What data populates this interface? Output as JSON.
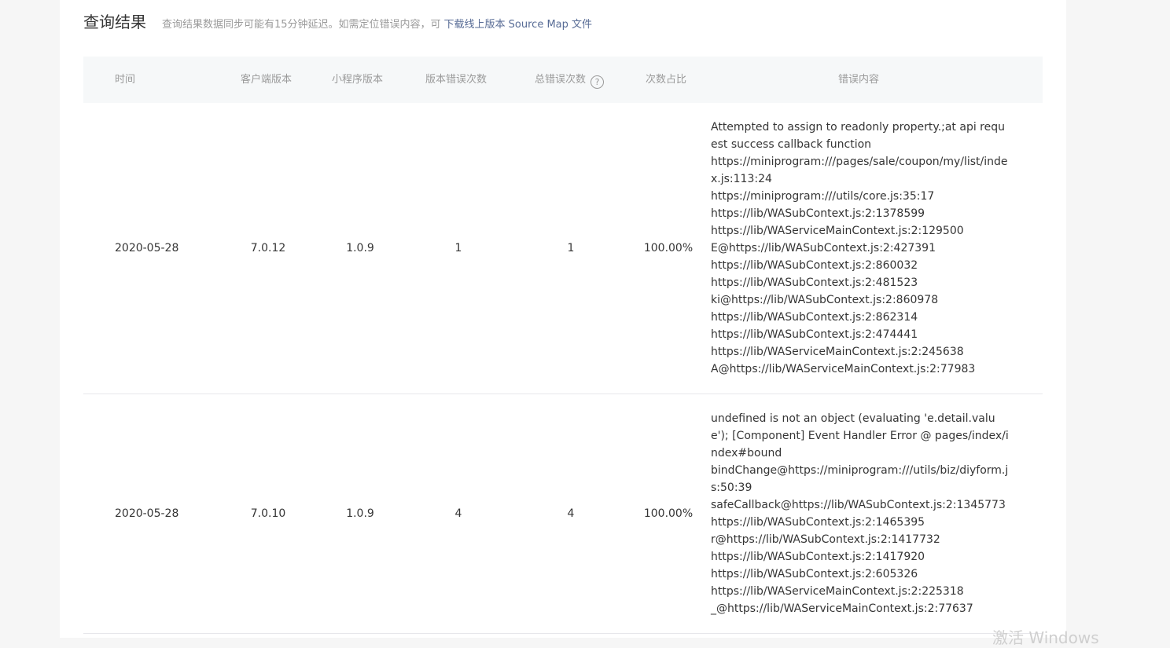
{
  "header": {
    "title": "查询结果",
    "tip": "查询结果数据同步可能有15分钟延迟。如需定位错误内容，可",
    "link": "下载线上版本 Source Map 文件"
  },
  "table": {
    "columns": {
      "time": "时间",
      "client_version": "客户端版本",
      "mini_version": "小程序版本",
      "version_errors": "版本错误次数",
      "total_errors": "总错误次数",
      "help": "?",
      "ratio": "次数占比",
      "content": "错误内容"
    },
    "rows": [
      {
        "time": "2020-05-28",
        "client_version": "7.0.12",
        "mini_version": "1.0.9",
        "version_errors": "1",
        "total_errors": "1",
        "ratio": "100.00%",
        "content": "Attempted to assign to readonly property.;at api request success callback function\nhttps://miniprogram:///pages/sale/coupon/my/list/index.js:113:24\nhttps://miniprogram:///utils/core.js:35:17\nhttps://lib/WASubContext.js:2:1378599\nhttps://lib/WAServiceMainContext.js:2:129500\nE@https://lib/WASubContext.js:2:427391\nhttps://lib/WASubContext.js:2:860032\nhttps://lib/WASubContext.js:2:481523\nki@https://lib/WASubContext.js:2:860978\nhttps://lib/WASubContext.js:2:862314\nhttps://lib/WASubContext.js:2:474441\nhttps://lib/WAServiceMainContext.js:2:245638\nA@https://lib/WAServiceMainContext.js:2:77983"
      },
      {
        "time": "2020-05-28",
        "client_version": "7.0.10",
        "mini_version": "1.0.9",
        "version_errors": "4",
        "total_errors": "4",
        "ratio": "100.00%",
        "content": "undefined is not an object (evaluating 'e.detail.value'); [Component] Event Handler Error @ pages/index/index#bound\nbindChange@https://miniprogram:///utils/biz/diyform.js:50:39\nsafeCallback@https://lib/WASubContext.js:2:1345773\nhttps://lib/WASubContext.js:2:1465395\nr@https://lib/WASubContext.js:2:1417732\nhttps://lib/WASubContext.js:2:1417920\nhttps://lib/WASubContext.js:2:605326\nhttps://lib/WAServiceMainContext.js:2:225318\n_@https://lib/WAServiceMainContext.js:2:77637"
      }
    ]
  },
  "watermark": "激活 Windows",
  "colors": {
    "link": "#576b95",
    "header_bg": "#f6f8f9",
    "muted_text": "#9a9a9a"
  }
}
